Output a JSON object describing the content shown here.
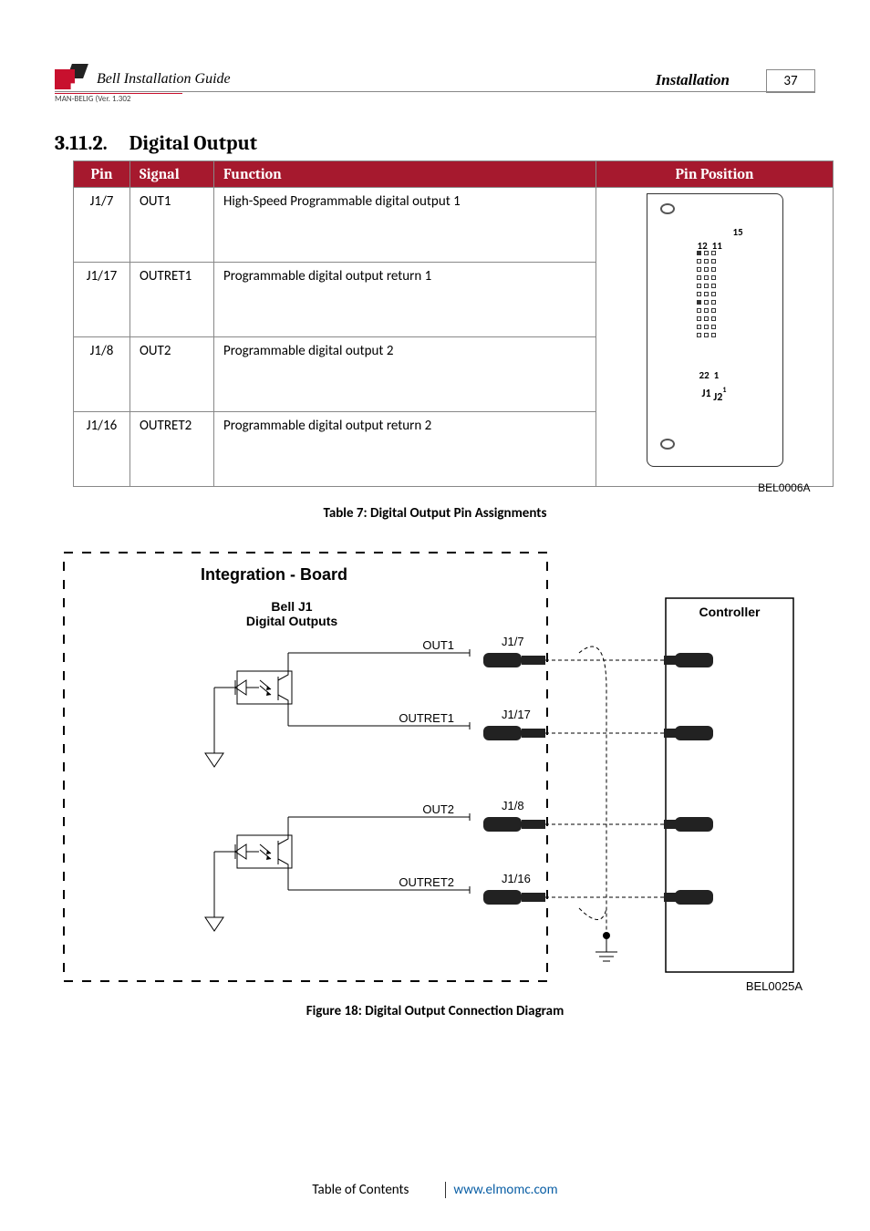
{
  "header": {
    "guide_title": "Bell Installation Guide",
    "section": "Installation",
    "page_number": "37",
    "version_line": "MAN-BELIG (Ver. 1.302"
  },
  "section_heading": {
    "number": "3.11.2.",
    "title": "Digital Output"
  },
  "table": {
    "headers": {
      "pin": "Pin",
      "signal": "Signal",
      "function": "Function",
      "position": "Pin Position"
    },
    "rows": [
      {
        "pin": "J1/7",
        "signal": "OUT1",
        "function": "High-Speed Programmable digital output 1"
      },
      {
        "pin": "J1/17",
        "signal": "OUTRET1",
        "function": "Programmable digital output return 1"
      },
      {
        "pin": "J1/8",
        "signal": "OUT2",
        "function": "Programmable digital output 2"
      },
      {
        "pin": "J1/16",
        "signal": "OUTRET2",
        "function": "Programmable digital output return 2"
      }
    ],
    "pin_position": {
      "label_15": "15",
      "label_12": "12",
      "label_11": "11",
      "label_22": "22",
      "label_1": "1",
      "label_j1": "J1",
      "label_j2": "J2",
      "diagram_code": "BEL0006A"
    },
    "caption": "Table 7: Digital Output Pin Assignments"
  },
  "figure": {
    "integration_board": "Integration - Board",
    "bell_j1_line1": "Bell J1",
    "bell_j1_line2": "Digital Outputs",
    "controller": "Controller",
    "out1": "OUT1",
    "outret1": "OUTRET1",
    "out2": "OUT2",
    "outret2": "OUTRET2",
    "j1_7": "J1/7",
    "j1_17": "J1/17",
    "j1_8": "J1/8",
    "j1_16": "J1/16",
    "diagram_code": "BEL0025A",
    "caption": "Figure 18: Digital Output Connection Diagram"
  },
  "footer": {
    "toc": "Table of Contents",
    "url": "www.elmomc.com"
  }
}
